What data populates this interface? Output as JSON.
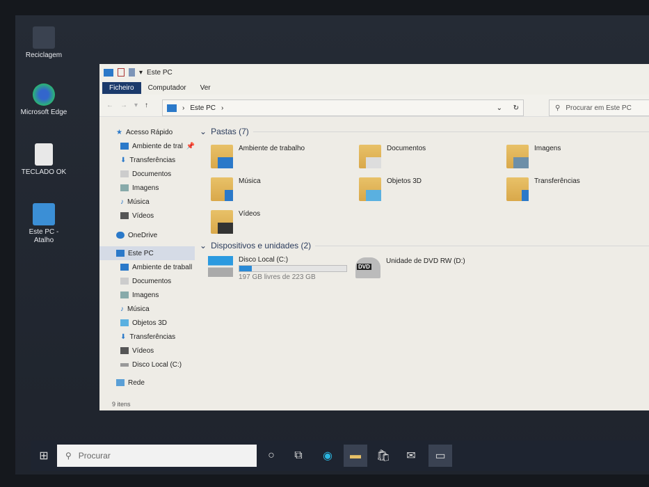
{
  "desktop": {
    "icons": [
      {
        "label": "Reciclagem"
      },
      {
        "label": "Microsoft Edge"
      },
      {
        "label": "TECLADO OK"
      },
      {
        "label": "Este PC - Atalho"
      }
    ]
  },
  "window": {
    "title": "Este PC",
    "ribbon_tabs": [
      "Ficheiro",
      "Computador",
      "Ver"
    ],
    "address": {
      "path": "Este PC",
      "separator": "›"
    },
    "search_placeholder": "Procurar em Este PC",
    "sidebar": {
      "quick_access": "Acesso Rápido",
      "quick_items": [
        "Ambiente de tral",
        "Transferências",
        "Documentos",
        "Imagens",
        "Música",
        "Vídeos"
      ],
      "onedrive": "OneDrive",
      "this_pc": "Este PC",
      "pc_items": [
        "Ambiente de traball",
        "Documentos",
        "Imagens",
        "Música",
        "Objetos 3D",
        "Transferências",
        "Vídeos",
        "Disco Local (C:)"
      ],
      "network": "Rede"
    },
    "status": "9 itens",
    "folders_header": "Pastas (7)",
    "folders": [
      "Ambiente de trabalho",
      "Documentos",
      "Imagens",
      "Música",
      "Objetos 3D",
      "Transferências",
      "Vídeos"
    ],
    "devices_header": "Dispositivos e unidades (2)",
    "drives": [
      {
        "name": "Disco Local (C:)",
        "free": "197 GB livres de 223 GB",
        "used_fraction": 0.12
      },
      {
        "name": "Unidade de DVD RW (D:)",
        "badge": "DVD"
      }
    ]
  },
  "taskbar": {
    "search_placeholder": "Procurar"
  },
  "colors": {
    "accent": "#1b3a6b",
    "bar": "#2a8ad6"
  }
}
